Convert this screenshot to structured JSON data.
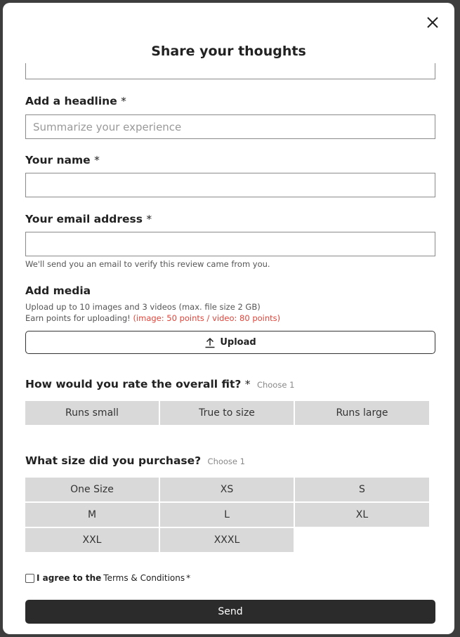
{
  "modal": {
    "title": "Share your thoughts",
    "close_icon": "close-icon"
  },
  "headline": {
    "label": "Add a headline",
    "required": "*",
    "placeholder": "Summarize your experience",
    "value": ""
  },
  "name": {
    "label": "Your name",
    "required": "*",
    "value": ""
  },
  "email": {
    "label": "Your email address",
    "required": "*",
    "value": "",
    "helper": "We'll send you an email to verify this review came from you."
  },
  "media": {
    "label": "Add media",
    "line1": "Upload up to 10 images and 3 videos (max. file size 2 GB)",
    "line2_prefix": "Earn points for uploading!",
    "line2_points": "(image: 50 points / video: 80 points)",
    "upload_label": "Upload",
    "upload_icon": "upload-icon"
  },
  "fit": {
    "question": "How would you rate the overall fit?",
    "required": "*",
    "hint": "Choose 1",
    "options": [
      "Runs small",
      "True to size",
      "Runs large"
    ]
  },
  "size": {
    "question": "What size did you purchase?",
    "hint": "Choose 1",
    "options": [
      "One Size",
      "XS",
      "S",
      "M",
      "L",
      "XL",
      "XXL",
      "XXXL"
    ]
  },
  "agree": {
    "prefix": "I agree to the",
    "link": "Terms & Conditions",
    "required": "*"
  },
  "send_label": "Send"
}
